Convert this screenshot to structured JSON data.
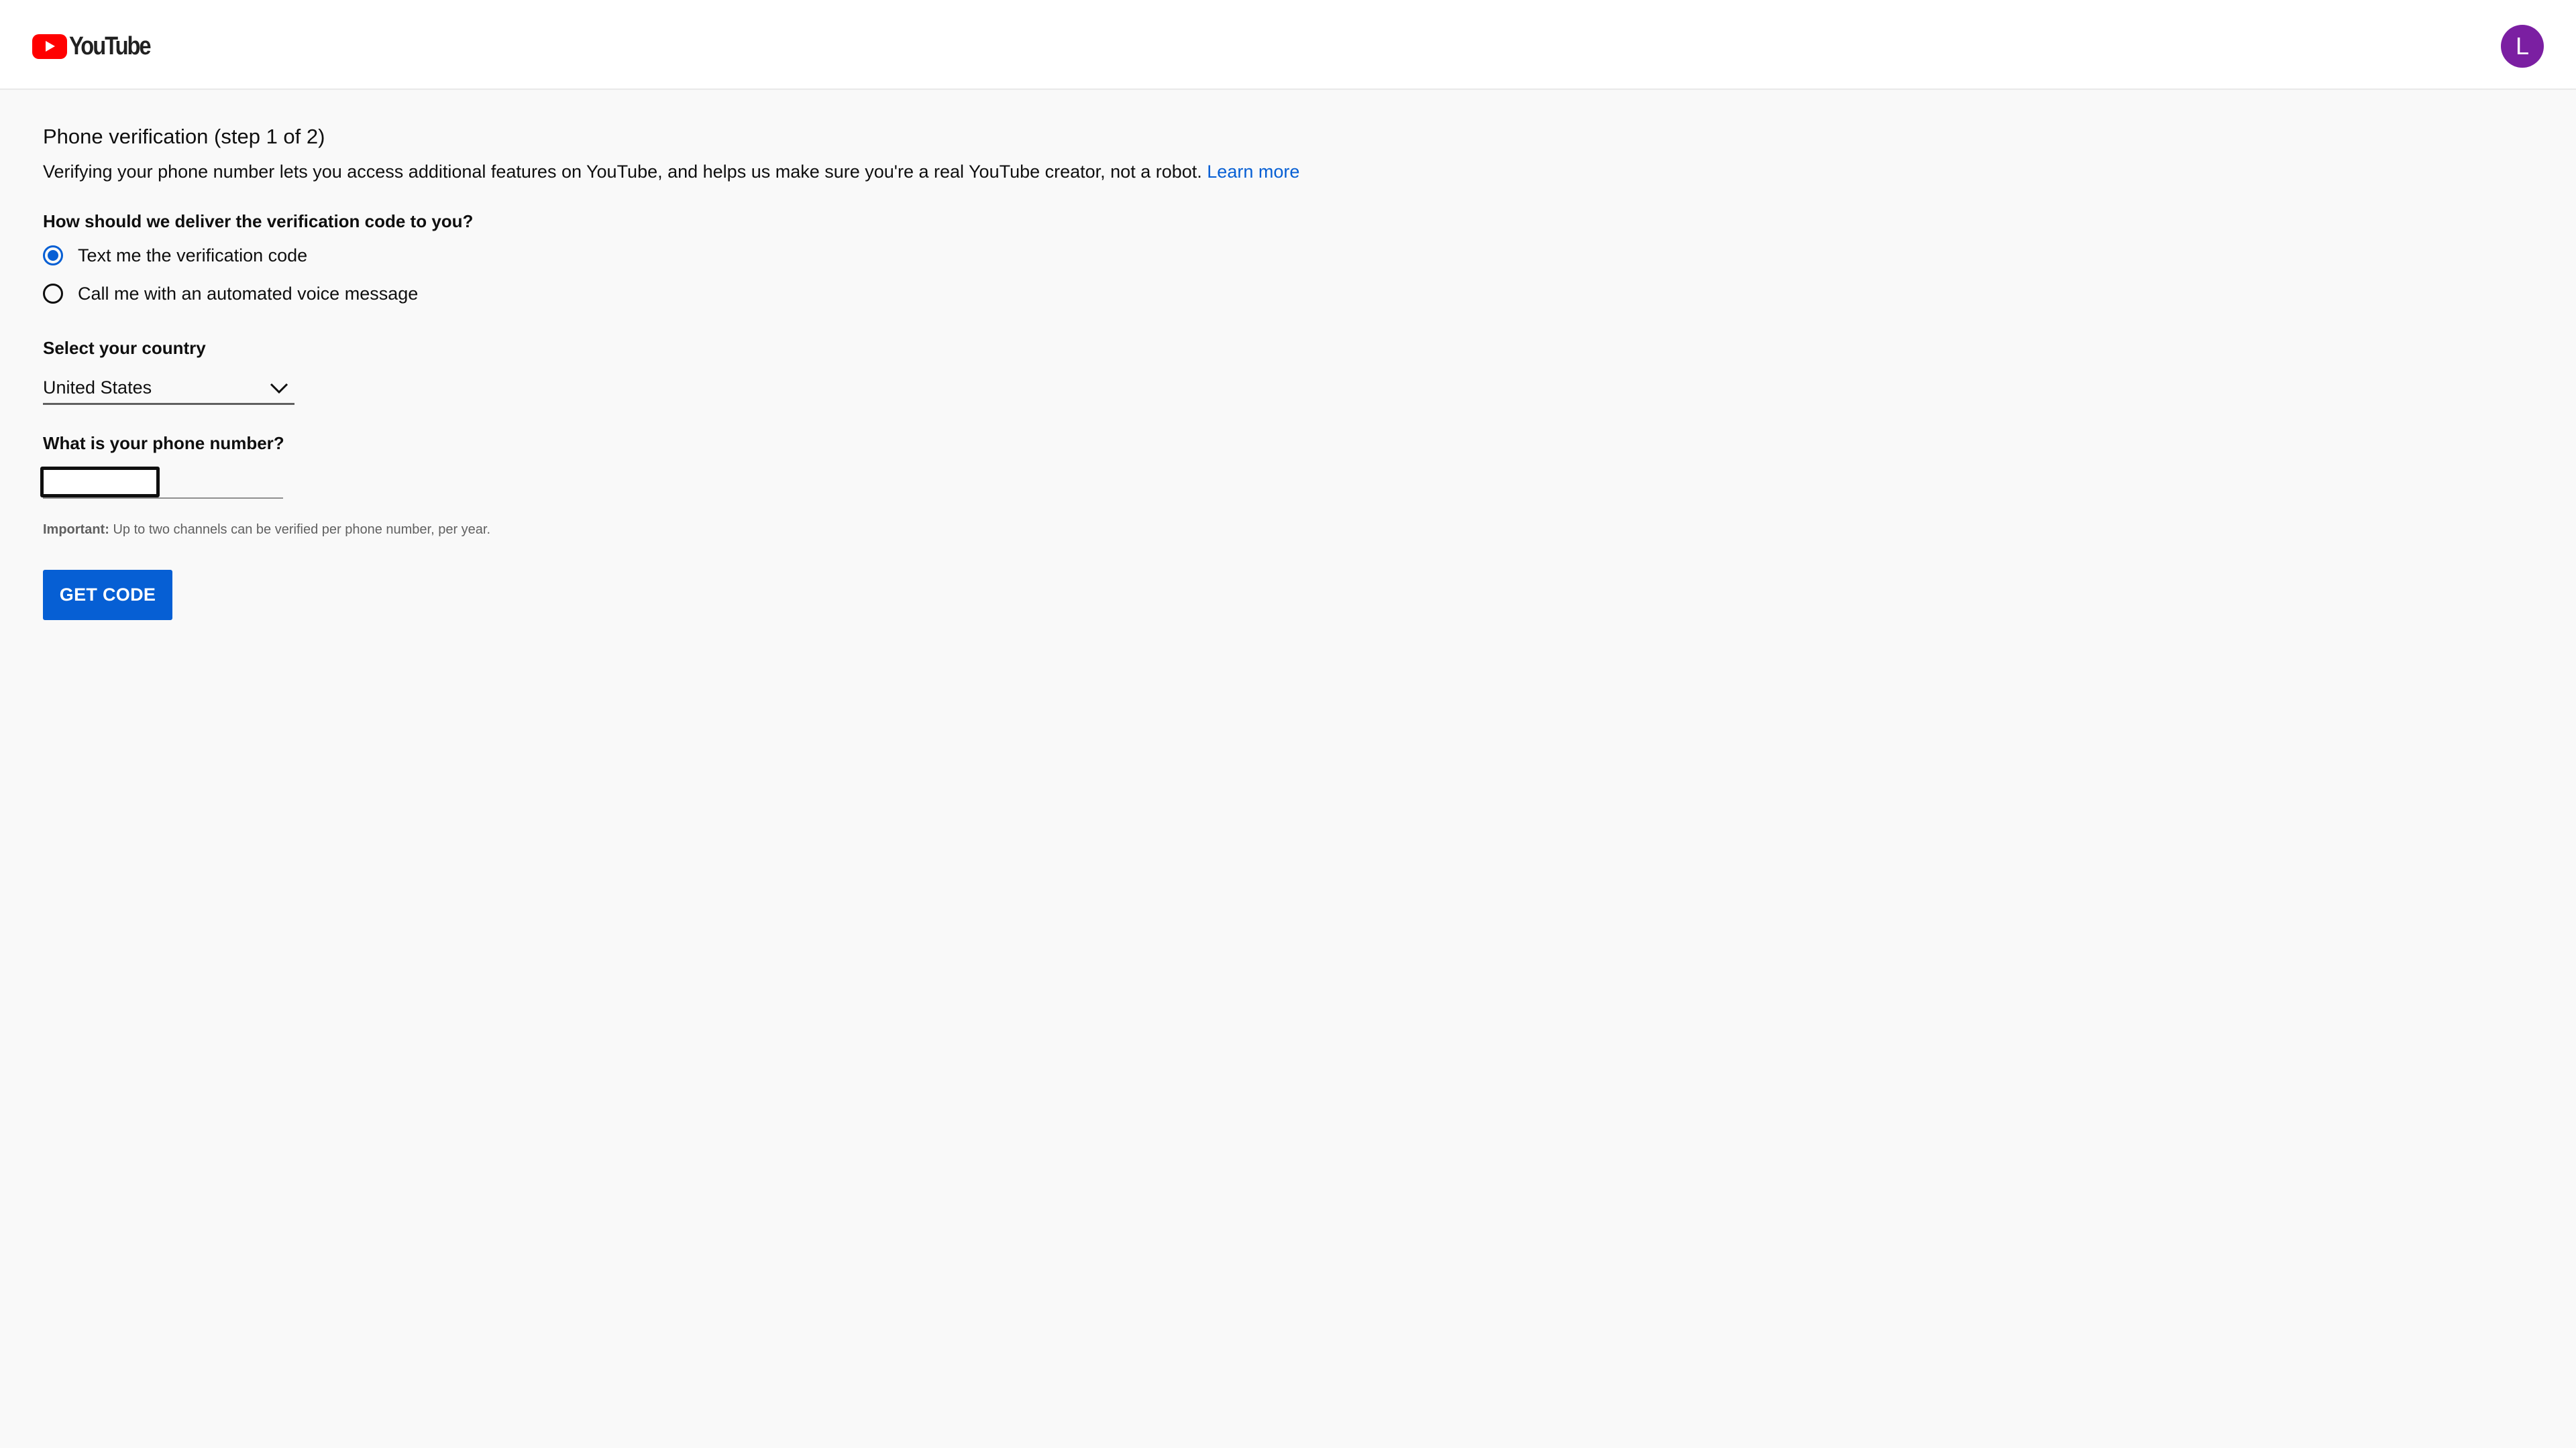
{
  "header": {
    "logo_text": "YouTube",
    "logo_icon": "youtube-play-icon",
    "avatar_letter": "L",
    "avatar_color": "#7b1fa2"
  },
  "page": {
    "title": "Phone verification (step 1 of 2)",
    "description": "Verifying your phone number lets you access additional features on YouTube, and helps us make sure you're a real YouTube creator, not a robot.",
    "learn_more": "Learn more"
  },
  "delivery": {
    "question": "How should we deliver the verification code to you?",
    "options": [
      {
        "label": "Text me the verification code",
        "selected": true
      },
      {
        "label": "Call me with an automated voice message",
        "selected": false
      }
    ]
  },
  "country": {
    "label": "Select your country",
    "selected": "United States"
  },
  "phone": {
    "label": "What is your phone number?",
    "value": ""
  },
  "note": {
    "prefix": "Important:",
    "text": "Up to two channels can be verified per phone number, per year."
  },
  "actions": {
    "get_code_label": "GET CODE"
  },
  "colors": {
    "accent": "#065fd4",
    "brand_red": "#ff0000",
    "background": "#f9f9f9"
  }
}
